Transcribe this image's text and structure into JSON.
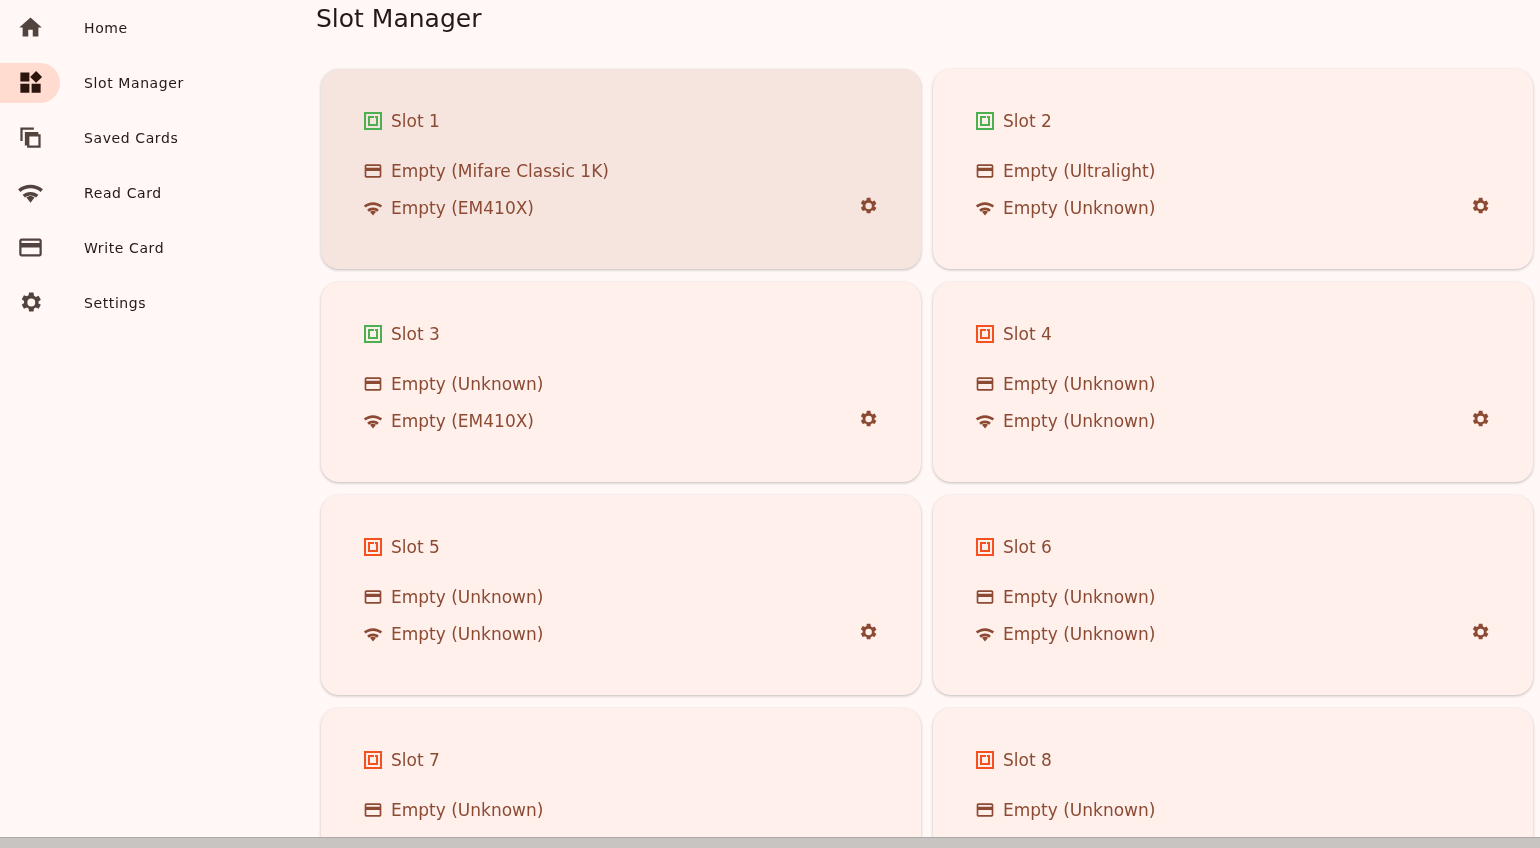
{
  "sidebar": {
    "items": [
      {
        "label": "Home",
        "selected": false
      },
      {
        "label": "Slot Manager",
        "selected": true
      },
      {
        "label": "Saved Cards",
        "selected": false
      },
      {
        "label": "Read Card",
        "selected": false
      },
      {
        "label": "Write Card",
        "selected": false
      },
      {
        "label": "Settings",
        "selected": false
      }
    ]
  },
  "page": {
    "title": "Slot Manager"
  },
  "slots": [
    {
      "name": "Slot 1",
      "color": "#4caf50",
      "selected": true,
      "hf": "Empty (Mifare Classic 1K)",
      "lf": "Empty (EM410X)"
    },
    {
      "name": "Slot 2",
      "color": "#4caf50",
      "selected": false,
      "hf": "Empty (Ultralight)",
      "lf": "Empty (Unknown)"
    },
    {
      "name": "Slot 3",
      "color": "#4caf50",
      "selected": false,
      "hf": "Empty (Unknown)",
      "lf": "Empty (EM410X)"
    },
    {
      "name": "Slot 4",
      "color": "#f4511e",
      "selected": false,
      "hf": "Empty (Unknown)",
      "lf": "Empty (Unknown)"
    },
    {
      "name": "Slot 5",
      "color": "#f4511e",
      "selected": false,
      "hf": "Empty (Unknown)",
      "lf": "Empty (Unknown)"
    },
    {
      "name": "Slot 6",
      "color": "#f4511e",
      "selected": false,
      "hf": "Empty (Unknown)",
      "lf": "Empty (Unknown)"
    },
    {
      "name": "Slot 7",
      "color": "#f4511e",
      "selected": false,
      "hf": "Empty (Unknown)"
    },
    {
      "name": "Slot 8",
      "color": "#f4511e",
      "selected": false,
      "hf": "Empty (Unknown)"
    }
  ]
}
